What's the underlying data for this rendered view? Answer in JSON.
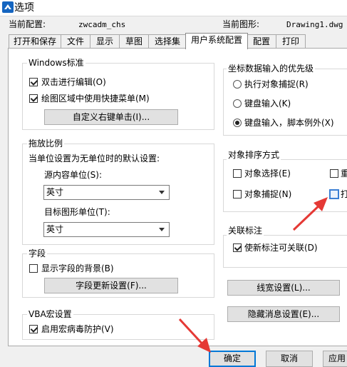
{
  "window": {
    "title": "选项"
  },
  "header": {
    "config_label": "当前配置:",
    "config_value": "zwcadm_chs",
    "drawing_label": "当前图形:",
    "drawing_value": "Drawing1.dwg"
  },
  "tabs": [
    "打开和保存",
    "文件",
    "显示",
    "草图",
    "选择集",
    "用户系统配置",
    "配置",
    "打印"
  ],
  "windows_std": {
    "title": "Windows标准",
    "dblclick_edit": "双击进行编辑(O)",
    "shortcut_menu": "绘图区域中使用快捷菜单(M)",
    "customize_btn": "自定义右键单击(I)..."
  },
  "insert_scale": {
    "title": "拖放比例",
    "desc": "当单位设置为无单位时的默认设置:",
    "source_label": "源内容单位(S):",
    "source_value": "英寸",
    "target_label": "目标图形单位(T):",
    "target_value": "英寸"
  },
  "fields": {
    "title": "字段",
    "show_background": "显示字段的背景(B)",
    "update_btn": "字段更新设置(F)..."
  },
  "vba": {
    "title": "VBA宏设置",
    "virus_protect": "启用宏病毒防护(V)"
  },
  "priority": {
    "title": "坐标数据输入的优先级",
    "osnap": "执行对象捕捉(R)",
    "keyboard": "键盘输入(K)",
    "keyboard_except": "键盘输入，脚本例外(X)"
  },
  "sort": {
    "title": "对象排序方式",
    "select": "对象选择(E)",
    "redo": "重",
    "snap": "对象捕捉(N)",
    "plot": "打"
  },
  "dim": {
    "title": "关联标注",
    "make_assoc": "使新标注可关联(D)"
  },
  "side_buttons": {
    "lineweight": "线宽设置(L)...",
    "hidden_msg": "隐藏消息设置(E)..."
  },
  "footer": {
    "ok": "确定",
    "cancel": "取消",
    "apply": "应用"
  },
  "colors": {
    "accent": "#0078d7",
    "annotation_arrow": "#e53935"
  }
}
